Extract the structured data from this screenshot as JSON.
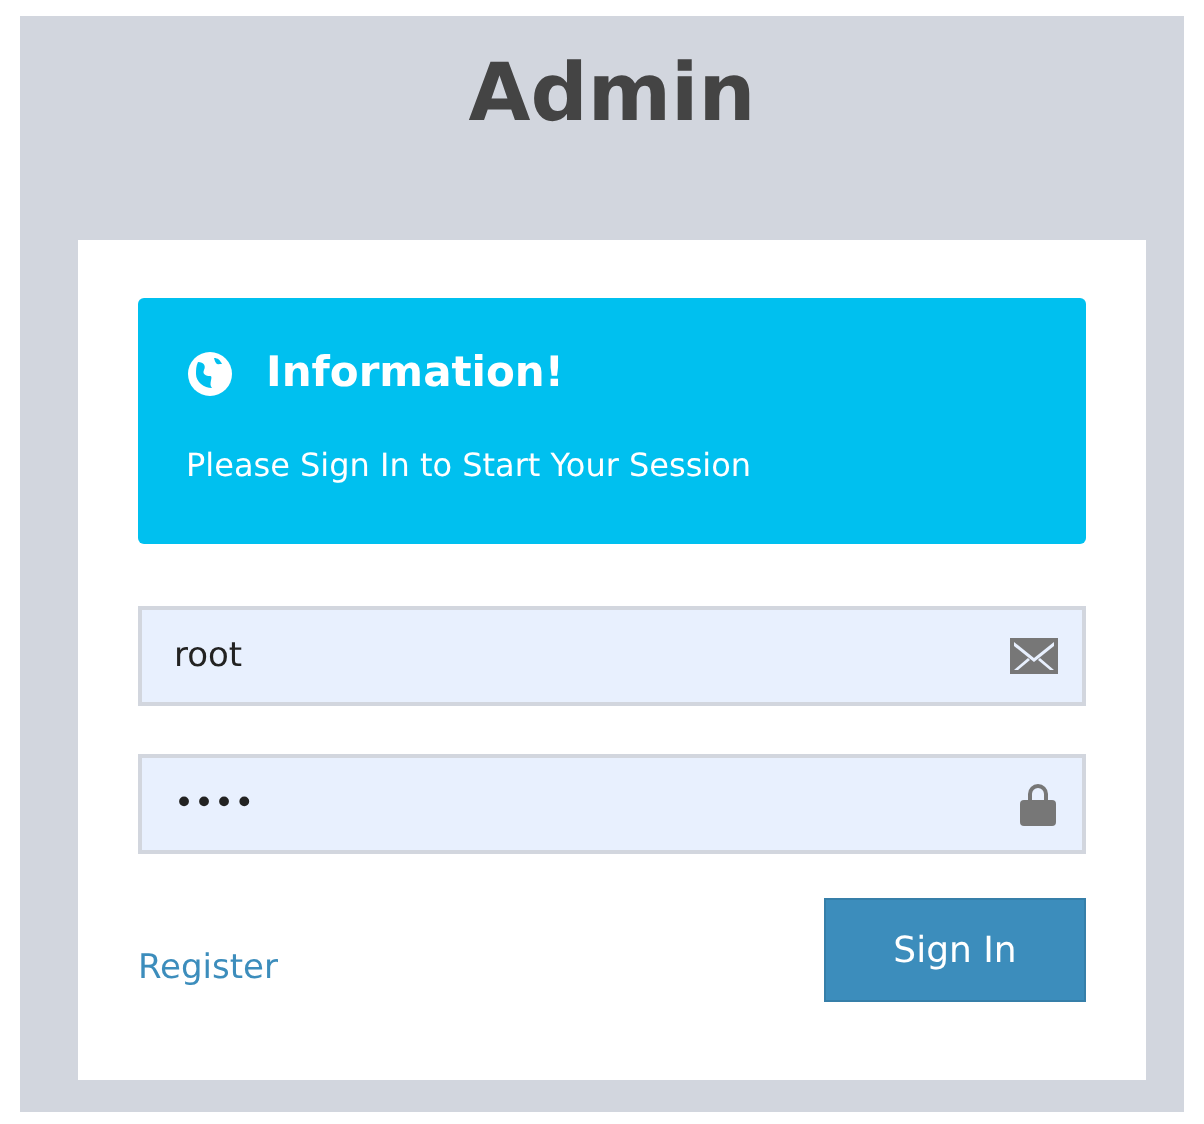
{
  "title": "Admin",
  "alert": {
    "heading": "Information!",
    "message": "Please Sign In to Start Your Session"
  },
  "fields": [
    {
      "kind": "email",
      "value": "root"
    },
    {
      "kind": "password",
      "value": "••••"
    }
  ],
  "register_link": "Register",
  "submit_button": "Sign In"
}
